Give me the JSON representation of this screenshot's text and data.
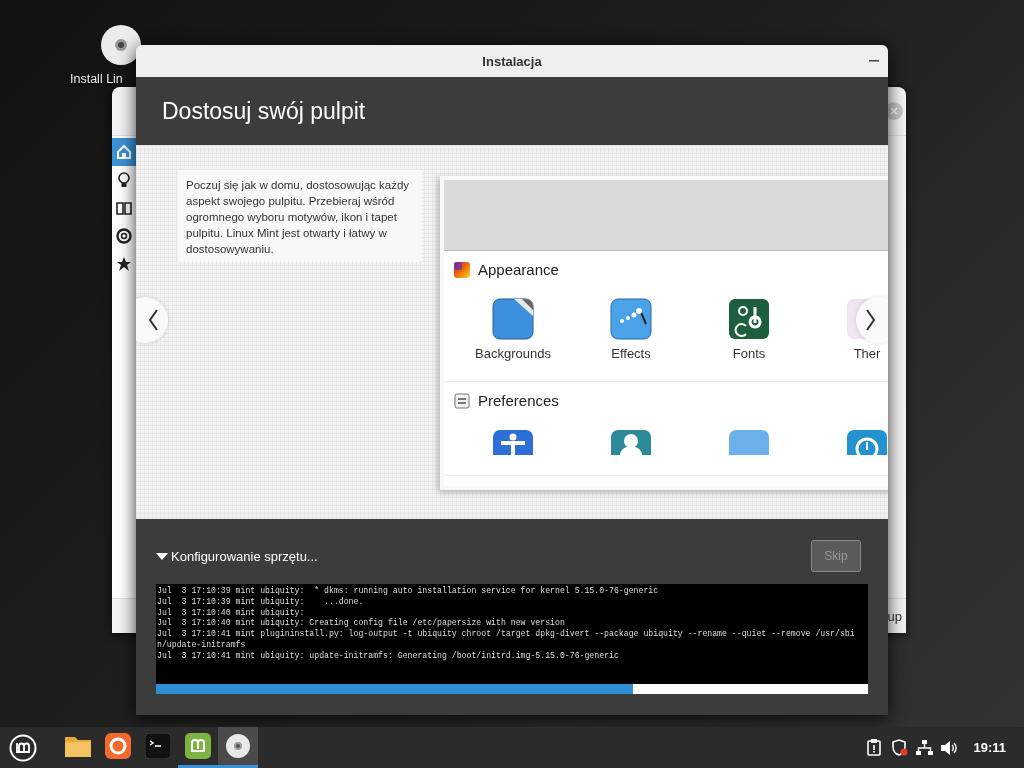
{
  "desktop": {
    "icons": [
      {
        "label": "Install Lin"
      }
    ]
  },
  "background_window": {
    "sidebar": [
      {
        "kind": "home",
        "selected": true
      },
      {
        "kind": "bulb",
        "selected": false
      },
      {
        "kind": "book",
        "selected": false
      },
      {
        "kind": "lifebuoy",
        "selected": false
      },
      {
        "kind": "star",
        "selected": false
      }
    ],
    "footer_text": "up"
  },
  "window": {
    "title": "Instalacja",
    "heading": "Dostosuj swój pulpit",
    "slide": {
      "text": "Poczuj się jak w domu, dostosowując każdy aspekt swojego pulpitu. Przebieraj wśród ogromnego wyboru motywów, ikon i tapet pulpitu. Linux Mint jest otwarty i łatwy w dostosowywaniu.",
      "screenshot": {
        "sections": [
          {
            "kind": "appearance",
            "title": "Appearance",
            "items": [
              {
                "kind": "backgrounds",
                "label": "Backgrounds"
              },
              {
                "kind": "effects",
                "label": "Effects"
              },
              {
                "kind": "fonts",
                "label": "Fonts"
              },
              {
                "kind": "themes",
                "label": "Ther"
              }
            ]
          },
          {
            "kind": "preferences",
            "title": "Preferences",
            "items": [
              {
                "kind": "accessibility"
              },
              {
                "kind": "account"
              },
              {
                "kind": "blank"
              },
              {
                "kind": "clock"
              }
            ]
          }
        ]
      }
    },
    "progress": {
      "label": "Konfigurowanie sprzętu...",
      "expanded": true,
      "skip": {
        "label": "Skip",
        "disabled": true
      },
      "log": [
        "Jul  3 17:10:39 mint ubiquity:  * dkms: running auto installation service for kernel 5.15.0-76-generic",
        "Jul  3 17:10:39 mint ubiquity:    ...done.",
        "Jul  3 17:10:40 mint ubiquity:",
        "Jul  3 17:10:40 mint ubiquity: Creating config file /etc/papersize with new version",
        "Jul  3 17:10:41 mint plugininstall.py: log-output -t ubiquity chroot /target dpkg-divert --package ubiquity --rename --quiet --remove /usr/sbi",
        "n/update-initramfs",
        "Jul  3 17:10:41 mint ubiquity: update-initramfs: Generating /boot/initrd.img-5.15.0-76-generic"
      ],
      "level": 0.67
    }
  },
  "taskbar": {
    "apps": [
      {
        "kind": "folder",
        "selected": false,
        "running": false
      },
      {
        "kind": "firefox",
        "selected": false,
        "running": false
      },
      {
        "kind": "terminal",
        "selected": false,
        "running": false
      },
      {
        "kind": "mintinstall",
        "selected": false,
        "running": true
      },
      {
        "kind": "disc",
        "selected": true,
        "running": true
      }
    ],
    "tray": [
      {
        "kind": "clipboard"
      },
      {
        "kind": "shield"
      },
      {
        "kind": "network"
      },
      {
        "kind": "volume"
      }
    ],
    "clock": "19:11"
  }
}
